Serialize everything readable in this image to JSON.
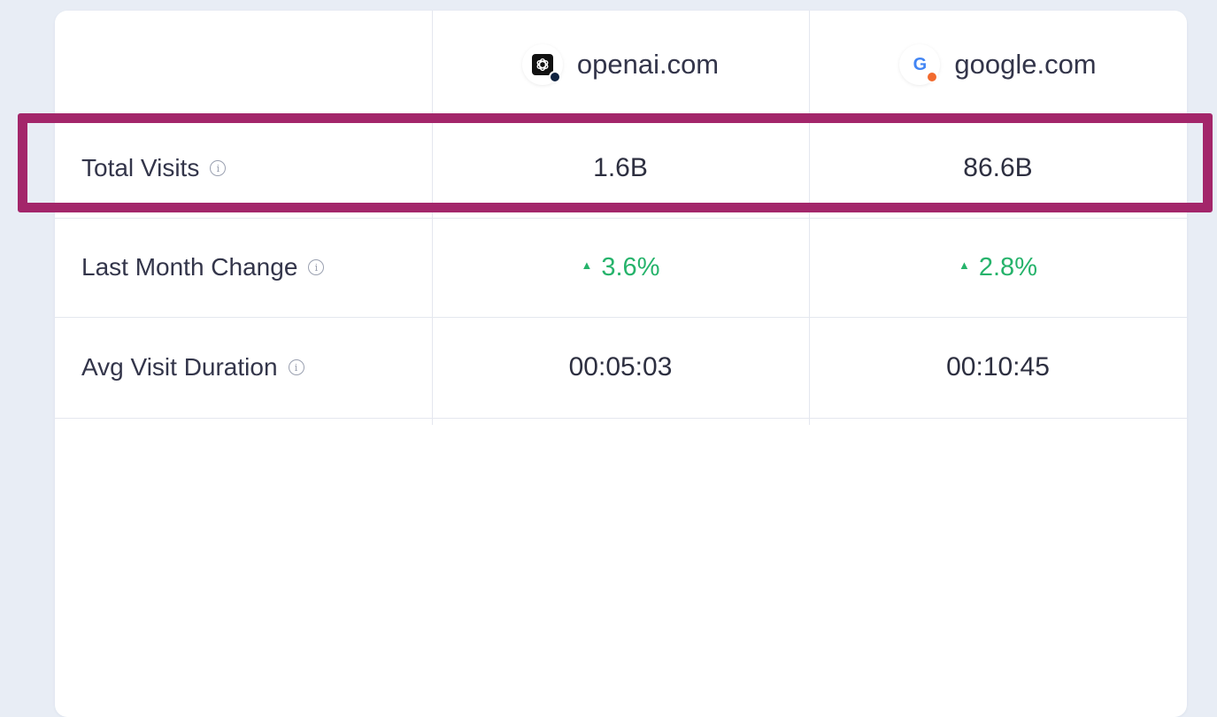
{
  "header": {
    "sites": [
      {
        "domain": "openai.com",
        "icon": "openai-logo-icon",
        "dot_color": "#0f2240"
      },
      {
        "domain": "google.com",
        "icon": "google-logo-icon",
        "icon_letter": "G",
        "dot_color": "#f26a2e"
      }
    ]
  },
  "rows": [
    {
      "label": "Total Visits",
      "values": [
        "1.6B",
        "86.6B"
      ]
    },
    {
      "label": "Last Month Change",
      "values": [
        "3.6%",
        "2.8%"
      ],
      "trend": "up",
      "trend_color": "#26b36b"
    },
    {
      "label": "Avg Visit Duration",
      "values": [
        "00:05:03",
        "00:10:45"
      ]
    }
  ],
  "info_glyph": "i",
  "highlight_color": "#a3266a"
}
